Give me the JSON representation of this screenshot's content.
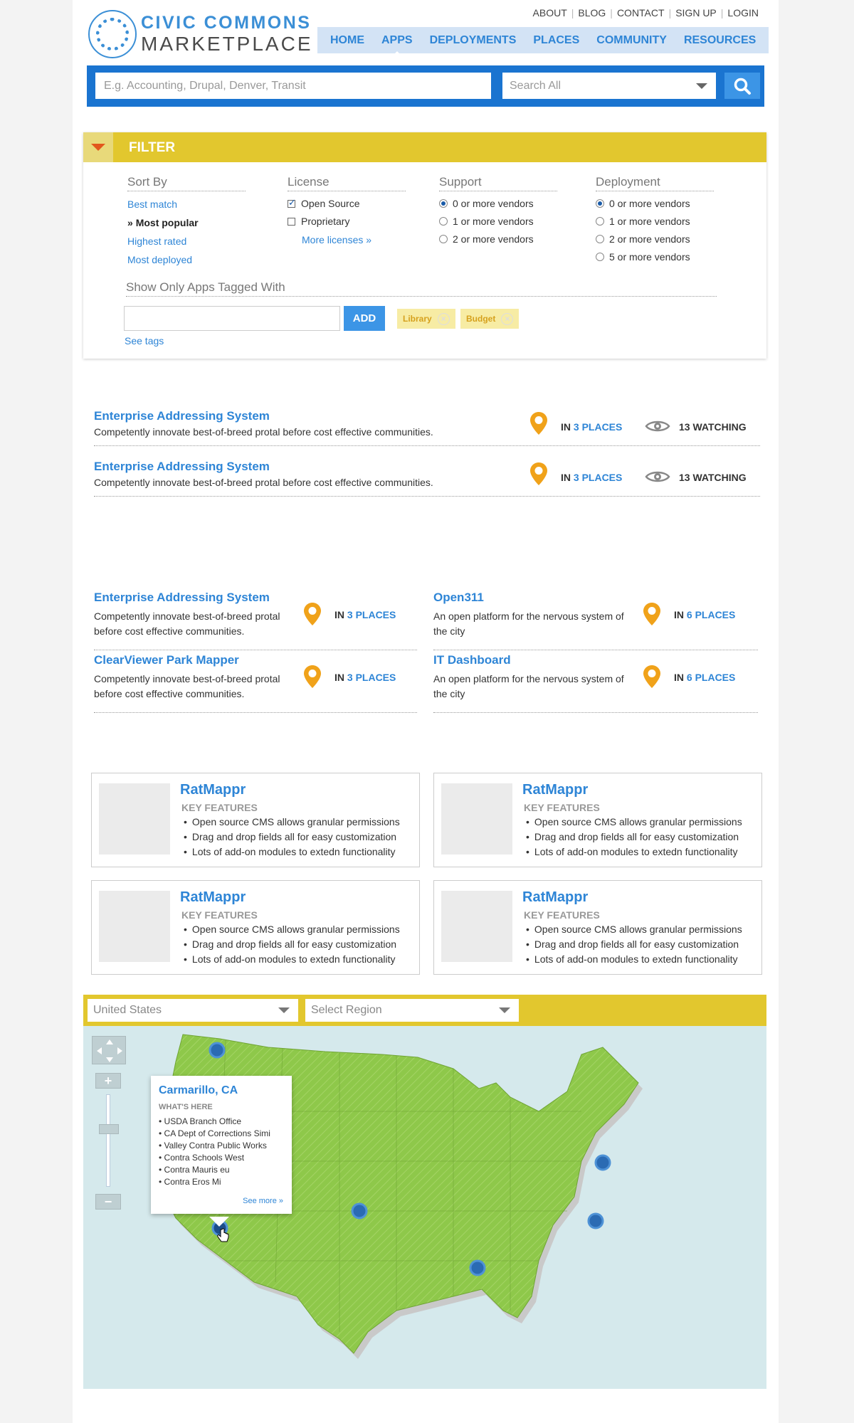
{
  "header": {
    "logo_line1": "CIVIC COMMONS",
    "logo_line2": "MARKETPLACE",
    "toplinks": [
      "ABOUT",
      "BLOG",
      "CONTACT",
      "SIGN UP",
      "LOGIN"
    ],
    "nav": [
      "HOME",
      "APPS",
      "DEPLOYMENTS",
      "PLACES",
      "COMMUNITY",
      "RESOURCES"
    ],
    "nav_active": "APPS"
  },
  "search": {
    "placeholder": "E.g. Accounting, Drupal, Denver, Transit",
    "scope": "Search All",
    "button_icon": "search-icon"
  },
  "filter": {
    "title": "FILTER",
    "sort": {
      "heading": "Sort By",
      "options": [
        "Best match",
        "Most popular",
        "Highest rated",
        "Most deployed"
      ],
      "selected": "Most popular"
    },
    "license": {
      "heading": "License",
      "options": [
        "Open Source",
        "Proprietary"
      ],
      "checked": [
        "Open Source"
      ],
      "more": "More licenses »"
    },
    "support": {
      "heading": "Support",
      "options": [
        "0 or more vendors",
        "1 or more vendors",
        "2 or more vendors"
      ],
      "selected": "0 or more vendors"
    },
    "deployment": {
      "heading": "Deployment",
      "options": [
        "0 or more vendors",
        "1 or more vendors",
        "2 or more vendors",
        "5 or more vendors"
      ],
      "selected": "0 or more vendors"
    },
    "tags": {
      "heading": "Show Only Apps Tagged With",
      "input_value": "",
      "add_label": "ADD",
      "chips": [
        "Library",
        "Budget"
      ],
      "see_tags": "See tags"
    }
  },
  "list_rows": [
    {
      "title": "Enterprise Addressing System",
      "desc": "Competently innovate best-of-breed protal before cost effective communities.",
      "in": "IN",
      "places": "3 PLACES",
      "watching": "13 WATCHING"
    },
    {
      "title": "Enterprise Addressing System",
      "desc": "Competently innovate best-of-breed protal before cost effective communities.",
      "in": "IN",
      "places": "3 PLACES",
      "watching": "13 WATCHING"
    }
  ],
  "grid": [
    {
      "title": "Enterprise Addressing System",
      "desc": "Competently innovate best-of-breed protal before cost effective communities.",
      "in": "IN",
      "places": "3 PLACES"
    },
    {
      "title": "Open311",
      "desc": "An open platform for the nervous system of the city",
      "in": "IN",
      "places": "6 PLACES"
    },
    {
      "title": "ClearViewer Park Mapper",
      "desc": "Competently innovate best-of-breed protal before cost effective communities.",
      "in": "IN",
      "places": "3 PLACES"
    },
    {
      "title": "IT Dashboard",
      "desc": "An open platform for the nervous system of the city",
      "in": "IN",
      "places": "6 PLACES"
    }
  ],
  "cards": [
    {
      "title": "RatMappr",
      "kf": "KEY FEATURES",
      "features": [
        "Open source CMS allows granular permissions",
        "Drag and drop fields all for easy customization",
        "Lots of add-on modules to extedn functionality"
      ]
    },
    {
      "title": "RatMappr",
      "kf": "KEY FEATURES",
      "features": [
        "Open source CMS allows granular permissions",
        "Drag and drop fields all for easy customization",
        "Lots of add-on modules to extedn functionality"
      ]
    },
    {
      "title": "RatMappr",
      "kf": "KEY FEATURES",
      "features": [
        "Open source CMS allows granular permissions",
        "Drag and drop fields all for easy customization",
        "Lots of add-on modules to extedn functionality"
      ]
    },
    {
      "title": "RatMappr",
      "kf": "KEY FEATURES",
      "features": [
        "Open source CMS allows granular permissions",
        "Drag and drop fields all for easy customization",
        "Lots of add-on modules to extedn functionality"
      ]
    }
  ],
  "map": {
    "country": "United States",
    "region_placeholder": "Select Region",
    "popup": {
      "title": "Carmarillo, CA",
      "heading": "WHAT'S HERE",
      "items": [
        "USDA Branch Office",
        "CA Dept of Corrections Simi",
        "Valley Contra Public Works",
        "Contra Schools West",
        "Contra Mauris eu",
        "Contra Eros Mi"
      ],
      "more": "See more »"
    },
    "zoom_in": "+",
    "zoom_out": "−"
  },
  "colors": {
    "brand_blue": "#2e85d6",
    "search_blue": "#1a74d0",
    "filter_yellow": "#e2c72e",
    "pin_orange": "#f0a21a",
    "map_green": "#8ec84a",
    "map_water": "#d5e9ec"
  }
}
